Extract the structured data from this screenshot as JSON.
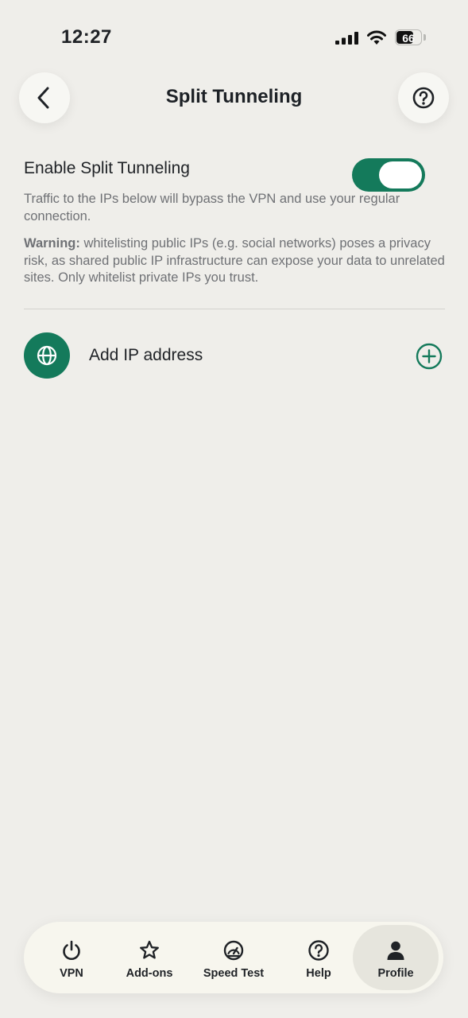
{
  "status_bar": {
    "time": "12:27",
    "battery": "66",
    "battery_level": 0.66
  },
  "header": {
    "title": "Split Tunneling"
  },
  "split_tunneling": {
    "enable_label": "Enable Split Tunneling",
    "enabled": true,
    "description": "Traffic to the IPs below will bypass the VPN and use your regular connection.",
    "warning_label": "Warning:",
    "warning_text": " whitelisting public IPs (e.g. social networks) poses a privacy risk, as shared public IP infrastructure can expose your data to unrelated sites. Only whitelist private IPs you trust."
  },
  "add_ip": {
    "label": "Add IP address"
  },
  "colors": {
    "accent": "#147a5b",
    "background": "#efeeea"
  },
  "nav": {
    "items": [
      {
        "label": "VPN",
        "icon": "power-icon"
      },
      {
        "label": "Add-ons",
        "icon": "star-icon"
      },
      {
        "label": "Speed Test",
        "icon": "speedometer-icon"
      },
      {
        "label": "Help",
        "icon": "help-circle-icon"
      },
      {
        "label": "Profile",
        "icon": "person-icon",
        "active": true
      }
    ]
  }
}
